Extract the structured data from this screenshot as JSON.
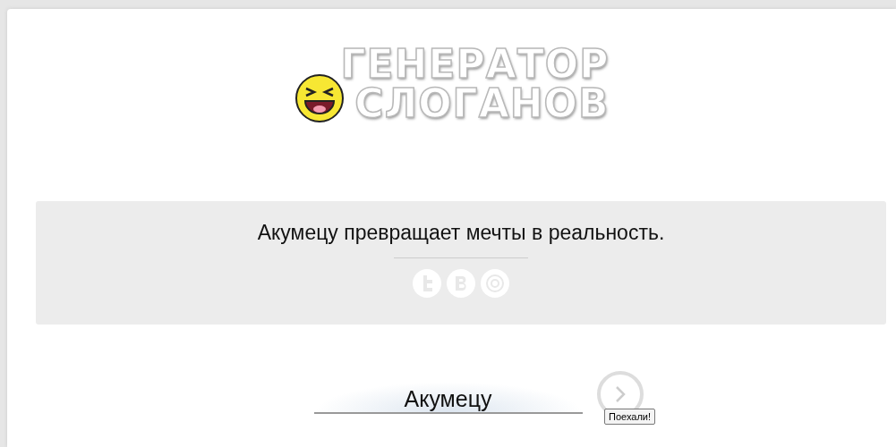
{
  "logo": {
    "line_1": "ГЕНЕРАТОР",
    "line_2": "СЛОГАНОВ"
  },
  "slogan": {
    "text": "Акумецу превращает мечты в реальность.",
    "share_icons": [
      {
        "kind": "twitter"
      },
      {
        "kind": "vk"
      },
      {
        "kind": "mail"
      }
    ]
  },
  "form": {
    "value": "Акумецу",
    "tooltip": "Поехали!"
  }
}
